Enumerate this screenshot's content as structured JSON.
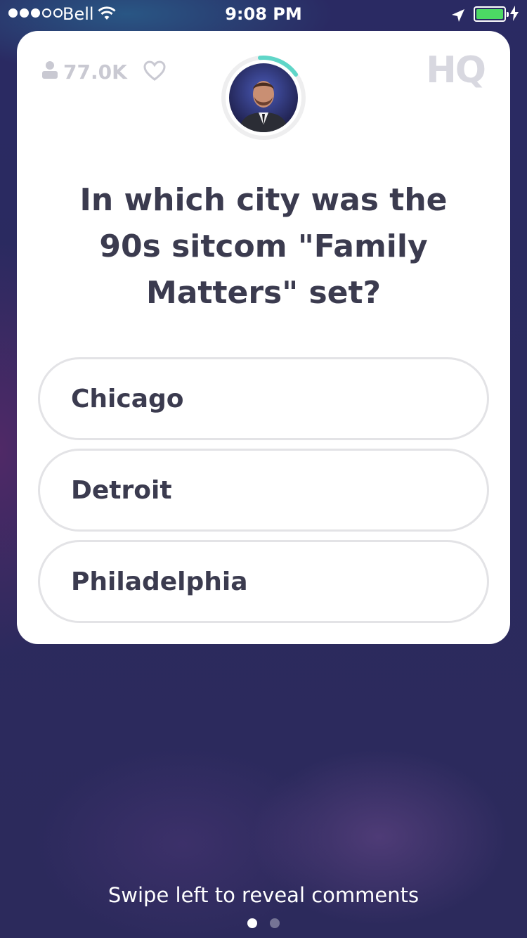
{
  "status_bar": {
    "carrier": "Bell",
    "time": "9:08 PM",
    "signal_bars_filled": 3,
    "signal_bars_total": 5,
    "battery_level": 1.0,
    "battery_color": "#4cd964"
  },
  "card": {
    "viewer_count": "77.0K",
    "logo": "HQ",
    "question": "In which city was the 90s sitcom \"Family Matters\" set?",
    "answers": [
      {
        "label": "Chicago"
      },
      {
        "label": "Detroit"
      },
      {
        "label": "Philadelphia"
      }
    ],
    "timer_accent": "#5fd6c8"
  },
  "footer": {
    "hint": "Swipe left to reveal comments",
    "pages_total": 2,
    "active_page": 1
  },
  "icons": [
    "signal-dots-icon",
    "wifi-icon",
    "location-arrow-icon",
    "battery-icon",
    "charging-bolt-icon",
    "person-icon",
    "heart-icon"
  ]
}
